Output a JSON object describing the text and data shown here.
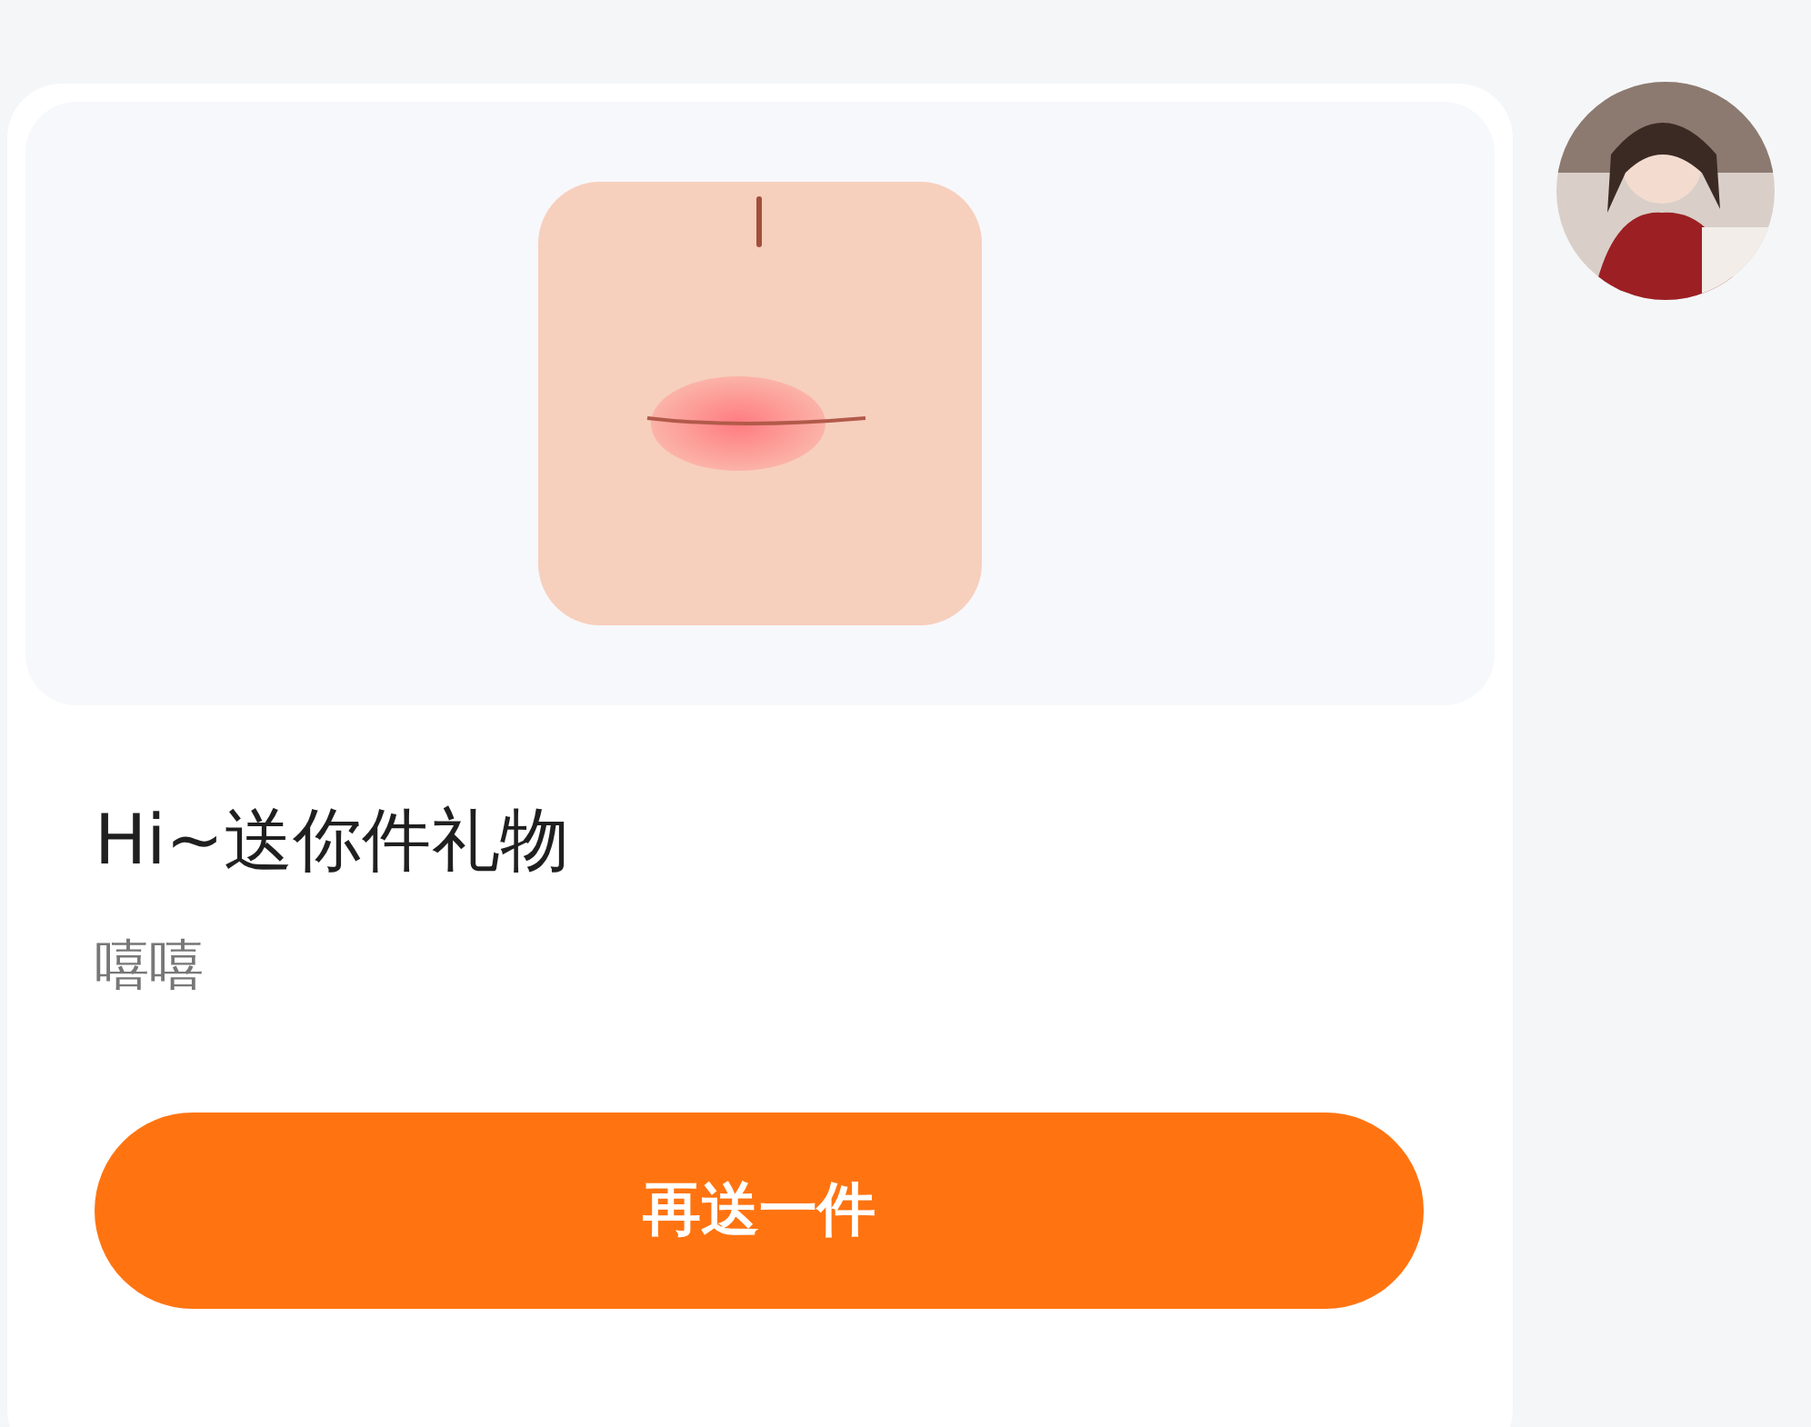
{
  "gift_card": {
    "title": "Hi~送你件礼物",
    "message": "嘻嘻",
    "button": "再送一件"
  }
}
